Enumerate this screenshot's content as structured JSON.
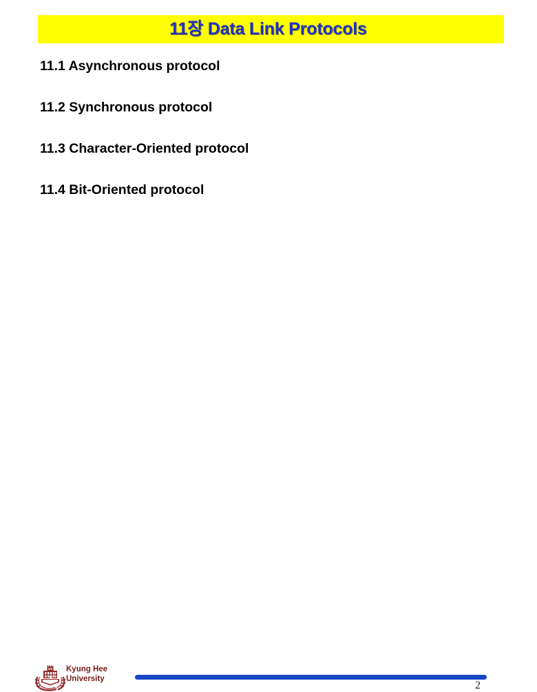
{
  "slide": {
    "background_color": "#ffffff",
    "title": {
      "text": "11장 Data Link Protocols",
      "banner_color": "#ffff00",
      "text_color": "#2030c8"
    },
    "body_lines": [
      {
        "text": "11.1 Asynchronous protocol"
      },
      {
        "text": "11.2 Synchronous protocol"
      },
      {
        "text": "11.3 Character-Oriented protocol"
      },
      {
        "text": "11.4 Bit-Oriented protocol"
      }
    ],
    "footer": {
      "logo_icon": "kyung-hee-crest-icon",
      "organization_line_1": "Kyung Hee",
      "organization_line_2": "University",
      "organization_color": "#7a1b1b",
      "rule_color": "#1746c8",
      "page_number": "2"
    }
  }
}
